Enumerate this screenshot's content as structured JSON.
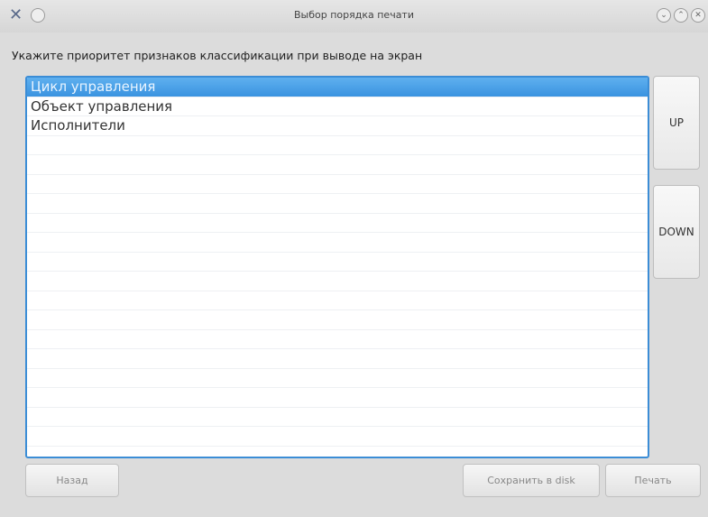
{
  "window": {
    "title": "Выбор порядка печати",
    "app_icon": "tools-icon",
    "buttons": [
      "minimize-icon",
      "maximize-icon",
      "close-icon"
    ]
  },
  "prompt": "Укажите приоритет признаков классификации при выводе на экран",
  "list": {
    "items": [
      {
        "label": "Цикл управления",
        "selected": true
      },
      {
        "label": "Объект управления",
        "selected": false
      },
      {
        "label": "Исполнители",
        "selected": false
      }
    ],
    "accent_color": "#3b8dd6"
  },
  "side_buttons": {
    "up": "UP",
    "down": "DOWN"
  },
  "bottom_buttons": {
    "back": "Назад",
    "save_to_disk": "Сохранить в disk",
    "print": "Печать"
  }
}
